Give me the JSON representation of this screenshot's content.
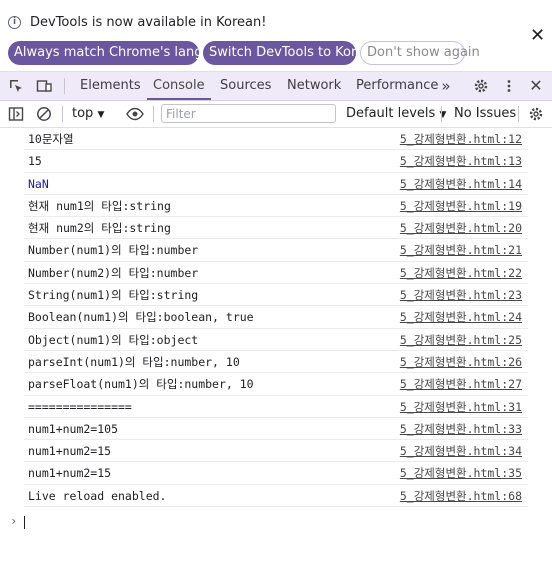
{
  "infobar": {
    "message": "DevTools is now available in Korean!",
    "btn_match": "Always match Chrome's language",
    "btn_switch": "Switch DevTools to Korean",
    "btn_dont_show": "Don't show again",
    "close_symbol": "✕"
  },
  "tabs": [
    {
      "label": "Elements"
    },
    {
      "label": "Console"
    },
    {
      "label": "Sources"
    },
    {
      "label": "Network"
    },
    {
      "label": "Performance"
    }
  ],
  "toolbar": {
    "context": "top",
    "filter_placeholder": "Filter",
    "levels": "Default levels",
    "issues": "No Issues"
  },
  "colors": {
    "accent": "#6b56a0",
    "tabbar_bg": "#efeaf7",
    "nan_blue": "#1a1aa6"
  },
  "messages": [
    {
      "text": "10문자열",
      "source": "5_강제형변환.html:12"
    },
    {
      "text": "15",
      "source": "5_강제형변환.html:13"
    },
    {
      "text": "NaN",
      "source": "5_강제형변환.html:14"
    },
    {
      "text": "현재 num1의 타입:string",
      "source": "5_강제형변환.html:19"
    },
    {
      "text": "현재 num2의 타입:string",
      "source": "5_강제형변환.html:20"
    },
    {
      "text": "Number(num1)의 타입:number",
      "source": "5_강제형변환.html:21"
    },
    {
      "text": "Number(num2)의 타입:number",
      "source": "5_강제형변환.html:22"
    },
    {
      "text": "String(num1)의 타입:string",
      "source": "5_강제형변환.html:23"
    },
    {
      "text": "Boolean(num1)의 타입:boolean, true",
      "source": "5_강제형변환.html:24"
    },
    {
      "text": "Object(num1)의 타입:object",
      "source": "5_강제형변환.html:25"
    },
    {
      "text": "parseInt(num1)의 타입:number, 10",
      "source": "5_강제형변환.html:26"
    },
    {
      "text": "parseFloat(num1)의 타입:number, 10",
      "source": "5_강제형변환.html:27"
    },
    {
      "text": "===============",
      "source": "5_강제형변환.html:31"
    },
    {
      "text": "num1+num2=105",
      "source": "5_강제형변환.html:33"
    },
    {
      "text": "num1+num2=15",
      "source": "5_강제형변환.html:34"
    },
    {
      "text": "num1+num2=15",
      "source": "5_강제형변환.html:35"
    },
    {
      "text": "Live reload enabled.",
      "source": "5_강제형변환.html:68"
    }
  ],
  "prompt_symbol": "›"
}
